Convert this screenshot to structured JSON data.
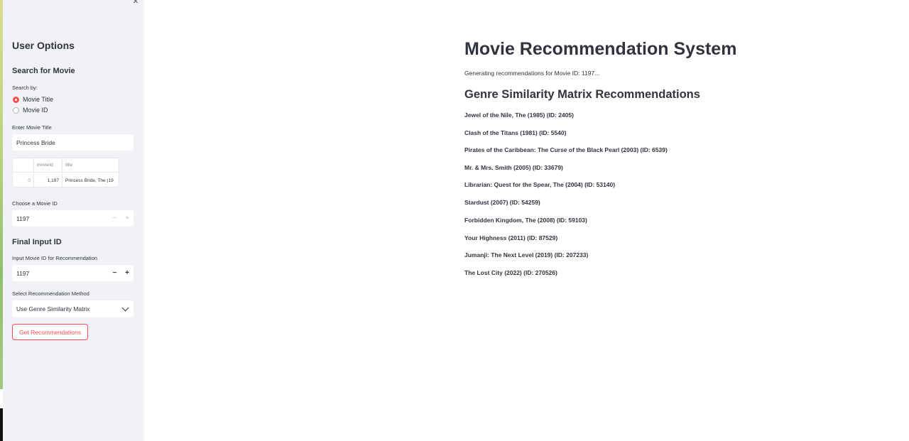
{
  "sidebar": {
    "close_icon": "×",
    "title": "User Options",
    "search_heading": "Search for Movie",
    "search_by_label": "Search by:",
    "radio_options": [
      "Movie Title",
      "Movie ID"
    ],
    "radio_selected": "Movie Title",
    "title_input_label": "Enter Movie Title",
    "title_input_value": "Princess Bride",
    "table": {
      "columns": [
        "",
        "movieId",
        "title"
      ],
      "rows": [
        [
          "0",
          "1,197",
          "Princess Bride, The (19"
        ]
      ]
    },
    "choose_label": "Choose a Movie ID",
    "choose_value": "1197",
    "final_heading": "Final Input ID",
    "input_id_label": "Input Movie ID for Recommendation",
    "input_id_value": "1197",
    "method_label": "Select Recommendation Method",
    "method_value": "Use Genre Similarity Matrix",
    "button_label": "Get Recommendations",
    "minus": "−",
    "plus": "+"
  },
  "main": {
    "title": "Movie Recommendation System",
    "status": "Generating recommendations for Movie ID: 1197...",
    "subtitle": "Genre Similarity Matrix Recommendations",
    "recommendations": [
      "Jewel of the Nile, The (1985) (ID: 2405)",
      "Clash of the Titans (1981) (ID: 5540)",
      "Pirates of the Caribbean: The Curse of the Black Pearl (2003) (ID: 6539)",
      "Mr. & Mrs. Smith (2005) (ID: 33679)",
      "Librarian: Quest for the Spear, The (2004) (ID: 53140)",
      "Stardust (2007) (ID: 54259)",
      "Forbidden Kingdom, The (2008) (ID: 59103)",
      "Your Highness (2011) (ID: 87529)",
      "Jumanji: The Next Level (2019) (ID: 207233)",
      "The Lost City (2022) (ID: 270526)"
    ]
  },
  "colors": {
    "accent": "#ff4b4b",
    "sidebar_bg": "#f0f2f6",
    "text": "#31333f"
  }
}
